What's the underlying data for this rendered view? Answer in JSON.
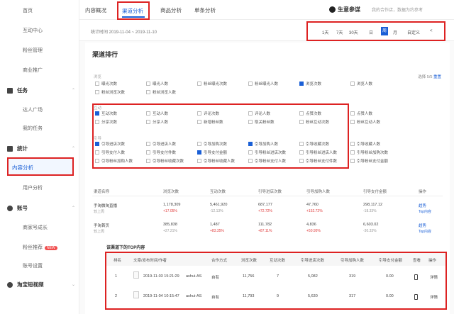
{
  "sidebar": {
    "top_items": [
      "首页",
      "互动中心",
      "粉丝管理",
      "商业推广"
    ],
    "tasks": {
      "title": "任务",
      "items": [
        "达人广场",
        "我的任务"
      ]
    },
    "stats": {
      "title": "统计",
      "active": "内容分析",
      "items": [
        "用户分析"
      ]
    },
    "account": {
      "title": "账号",
      "items": [
        "商家号成长",
        "粉丝推荐",
        "账号设置"
      ],
      "new_badge": "NEW"
    },
    "shortvideo": {
      "title": "淘宝短视频"
    }
  },
  "tabs": {
    "items": [
      "内容概况",
      "渠道分析",
      "商品分析",
      "单条分析"
    ],
    "active_index": 1
  },
  "brand": {
    "name": "生意参谋",
    "note": "我的合作店，数据为约参考"
  },
  "datebar": {
    "range_text": "统计时间 2019-11-04 ~ 2019-11-10",
    "options": [
      "1天",
      "7天",
      "30天",
      "日",
      "周",
      "月",
      "自定义",
      "<"
    ],
    "active": "周"
  },
  "channel": {
    "title": "渠道排行",
    "selected_text": "选择 5/5",
    "reset": "重置",
    "groups": [
      {
        "label": "浏览",
        "metrics": [
          {
            "name": "曝光次数",
            "checked": false
          },
          {
            "name": "曝光人数",
            "checked": false
          },
          {
            "name": "粉丝曝光次数",
            "checked": false
          },
          {
            "name": "粉丝曝光人数",
            "checked": false
          },
          {
            "name": "浏览次数",
            "checked": true
          },
          {
            "name": "浏览人数",
            "checked": false
          },
          {
            "name": "粉丝浏览次数",
            "checked": false
          },
          {
            "name": "粉丝浏览人数",
            "checked": false
          }
        ]
      },
      {
        "label": "互动",
        "metrics": [
          {
            "name": "互动次数",
            "checked": true
          },
          {
            "name": "互动人数",
            "checked": false
          },
          {
            "name": "评论次数",
            "checked": false
          },
          {
            "name": "评论人数",
            "checked": false
          },
          {
            "name": "点赞次数",
            "checked": false
          },
          {
            "name": "点赞人数",
            "checked": false
          },
          {
            "name": "分享次数",
            "checked": false
          },
          {
            "name": "分享人数",
            "checked": false
          },
          {
            "name": "新增粉丝数",
            "checked": false
          },
          {
            "name": "取关粉丝数",
            "checked": false
          },
          {
            "name": "粉丝互动次数",
            "checked": false
          },
          {
            "name": "粉丝互动人数",
            "checked": false
          }
        ]
      },
      {
        "label": "引导",
        "metrics": [
          {
            "name": "引导进店次数",
            "checked": true
          },
          {
            "name": "引导进店人数",
            "checked": false
          },
          {
            "name": "引导加购次数",
            "checked": false
          },
          {
            "name": "引导加购人数",
            "checked": true
          },
          {
            "name": "引导收藏次数",
            "checked": false
          },
          {
            "name": "引导收藏人数",
            "checked": false
          },
          {
            "name": "引导支付人数",
            "checked": false
          },
          {
            "name": "引导支付件数",
            "checked": false
          },
          {
            "name": "引导支付金额",
            "checked": true
          },
          {
            "name": "引导粉丝进店次数",
            "checked": false
          },
          {
            "name": "引导粉丝进店人数",
            "checked": false
          },
          {
            "name": "引导粉丝加购次数",
            "checked": false
          },
          {
            "name": "引导粉丝加购人数",
            "checked": false
          },
          {
            "name": "引导粉丝收藏次数",
            "checked": false
          },
          {
            "name": "引导粉丝收藏人数",
            "checked": false
          },
          {
            "name": "引导粉丝支付人数",
            "checked": false
          },
          {
            "name": "引导粉丝支付件数",
            "checked": false
          },
          {
            "name": "引导粉丝支付金额",
            "checked": false
          }
        ]
      }
    ]
  },
  "rank_table": {
    "headers": [
      "渠道名称",
      "浏览次数",
      "互动次数",
      "引导进店次数",
      "引导加购人数",
      "引导支付金额",
      "操作"
    ],
    "rows": [
      {
        "name": "手淘微淘直播",
        "sub": "较上周",
        "values": [
          "1,178,309",
          "5,461,920",
          "687,177",
          "47,760",
          "298,117.12"
        ],
        "changes": [
          {
            "text": "+17.05%",
            "c": "red"
          },
          {
            "text": "-12.13%",
            "c": "gray"
          },
          {
            "text": "+72.72%",
            "c": "red"
          },
          {
            "text": "+152.72%",
            "c": "red"
          },
          {
            "text": "-18.33%",
            "c": "gray"
          }
        ],
        "actions": [
          "趋势",
          "Top内容"
        ]
      },
      {
        "name": "手淘首页",
        "sub": "较上周",
        "values": [
          "385,838",
          "1,487",
          "111,782",
          "4,836",
          "6,603.02"
        ],
        "changes": [
          {
            "text": "+27.21%",
            "c": "gray"
          },
          {
            "text": "+83.35%",
            "c": "red"
          },
          {
            "text": "+87.11%",
            "c": "red"
          },
          {
            "text": "+50.95%",
            "c": "red"
          },
          {
            "text": "-30.33%",
            "c": "gray"
          }
        ],
        "actions": [
          "趋势",
          "Top内容"
        ]
      }
    ]
  },
  "top_content": {
    "title": "该渠道下的TOP内容",
    "headers": [
      "排名",
      "文章/发布时间/作者",
      "合作方式",
      "浏览次数",
      "互动次数",
      "引导进店次数",
      "引导加购人数",
      "引导支付金额",
      "查看",
      "操作"
    ],
    "rows": [
      {
        "rank": "1",
        "time": "2019-11-03 15:21:29",
        "author": "ashui-AS",
        "mode": "自有",
        "views": "11,756",
        "interact": "7",
        "store": "5,082",
        "cart": "319",
        "pay": "0.00",
        "action": "详情"
      },
      {
        "rank": "2",
        "time": "2019-11-04 10:15:47",
        "author": "ashui-AS",
        "mode": "自有",
        "views": "11,793",
        "interact": "9",
        "store": "5,630",
        "cart": "317",
        "pay": "0.00",
        "action": "详情"
      }
    ]
  },
  "colors": {
    "accent": "#1a5fd6",
    "highlight": "#dd2222",
    "up": "#e03c3c"
  }
}
